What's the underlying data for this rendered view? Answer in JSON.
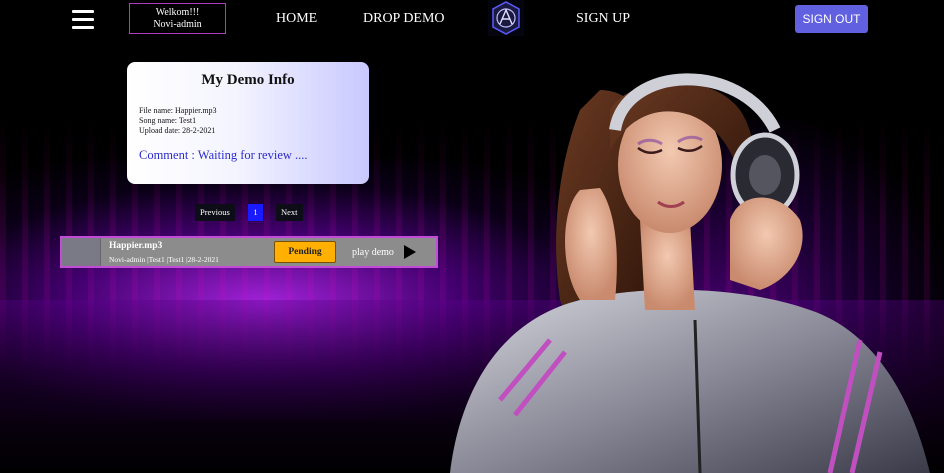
{
  "nav": {
    "welcome_line1": "Welkom!!!",
    "welcome_line2": "Novi-admin",
    "home": "HOME",
    "drop_demo": "DROP DEMO",
    "sign_up": "SIGN UP",
    "sign_out": "SIGN OUT"
  },
  "card": {
    "title": "My Demo Info",
    "file_name": "File name: Happier.mp3",
    "song_name": "Song name: Test1",
    "upload_date": "Upload date: 28-2-2021",
    "comment": "Comment : Waiting for review ...."
  },
  "pager": {
    "previous": "Previous",
    "page": "1",
    "next": "Next"
  },
  "demo_row": {
    "file_name": "Happier.mp3",
    "details": "Novi-admin |Test1 |Test1 |28-2-2021",
    "status": "Pending",
    "play_label": "play demo"
  },
  "colors": {
    "accent": "#6060e0",
    "pending": "#ffb000",
    "comment": "#2b2bcf",
    "row_border": "#c24bd8"
  }
}
